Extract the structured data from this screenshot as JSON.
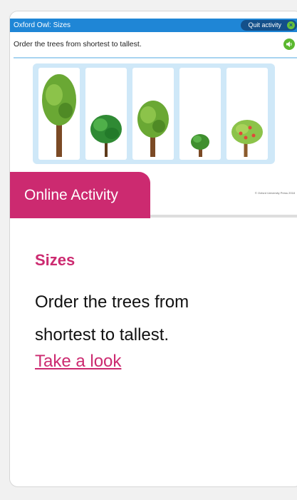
{
  "preview": {
    "app_title": "Oxford Owl: Sizes",
    "quit_label": "Quit activity",
    "instruction": "Order the trees from shortest to tallest.",
    "copyright": "© Oxford University Press 2018",
    "trees": [
      {
        "name": "tall-tree"
      },
      {
        "name": "short-bushy-tree"
      },
      {
        "name": "medium-tree"
      },
      {
        "name": "small-tree"
      },
      {
        "name": "apple-tree"
      }
    ]
  },
  "card": {
    "badge": "Online Activity",
    "heading": "Sizes",
    "description": "Order the trees from shortest to tallest.",
    "link_text": "Take a look"
  },
  "colors": {
    "accent": "#cc2a70",
    "topbar": "#1f86d6",
    "frame": "#cfe8f8"
  }
}
